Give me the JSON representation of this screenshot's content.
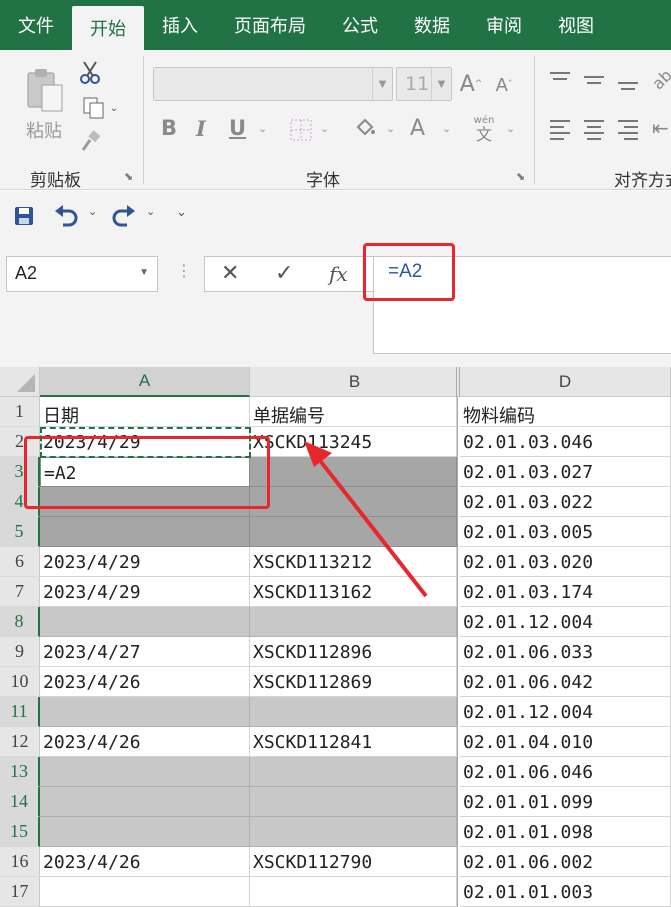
{
  "tabs": [
    "文件",
    "开始",
    "插入",
    "页面布局",
    "公式",
    "数据",
    "审阅",
    "视图"
  ],
  "active_tab": "开始",
  "clipboard": {
    "paste_label": "粘贴",
    "group_label": "剪贴板"
  },
  "font": {
    "size": "11",
    "group_label": "字体",
    "bold": "B",
    "italic": "I",
    "underline": "U",
    "font_color": "A",
    "grow": "A",
    "shrink": "A",
    "phonetic": "wén",
    "phonetic_char": "文"
  },
  "alignment": {
    "group_label": "对齐方式"
  },
  "formula_bar": {
    "name_box": "A2",
    "cancel": "✕",
    "enter": "✓",
    "fx": "fx",
    "formula": "=A2"
  },
  "sheet": {
    "columns": [
      "A",
      "B",
      "D"
    ],
    "editing_value": "=A2",
    "rows": [
      {
        "num": "1",
        "a": "日期",
        "b": "单据编号",
        "d": "物料编码",
        "style": "normal"
      },
      {
        "num": "2",
        "a": "2023/4/29",
        "b": "XSCKD113245",
        "d": "02.01.03.046",
        "style": "normal"
      },
      {
        "num": "3",
        "a": "",
        "b": "",
        "d": "02.01.03.027",
        "style": "dark"
      },
      {
        "num": "4",
        "a": "",
        "b": "",
        "d": "02.01.03.022",
        "style": "dark"
      },
      {
        "num": "5",
        "a": "",
        "b": "",
        "d": "02.01.03.005",
        "style": "dark"
      },
      {
        "num": "6",
        "a": "2023/4/29",
        "b": "XSCKD113212",
        "d": "02.01.03.020",
        "style": "normal"
      },
      {
        "num": "7",
        "a": "2023/4/29",
        "b": "XSCKD113162",
        "d": "02.01.03.174",
        "style": "normal"
      },
      {
        "num": "8",
        "a": "",
        "b": "",
        "d": "02.01.12.004",
        "style": "light"
      },
      {
        "num": "9",
        "a": "2023/4/27",
        "b": "XSCKD112896",
        "d": "02.01.06.033",
        "style": "normal"
      },
      {
        "num": "10",
        "a": "2023/4/26",
        "b": "XSCKD112869",
        "d": "02.01.06.042",
        "style": "normal"
      },
      {
        "num": "11",
        "a": "",
        "b": "",
        "d": "02.01.12.004",
        "style": "light"
      },
      {
        "num": "12",
        "a": "2023/4/26",
        "b": "XSCKD112841",
        "d": "02.01.04.010",
        "style": "normal"
      },
      {
        "num": "13",
        "a": "",
        "b": "",
        "d": "02.01.06.046",
        "style": "light"
      },
      {
        "num": "14",
        "a": "",
        "b": "",
        "d": "02.01.01.099",
        "style": "light"
      },
      {
        "num": "15",
        "a": "",
        "b": "",
        "d": "02.01.01.098",
        "style": "light"
      },
      {
        "num": "16",
        "a": "2023/4/26",
        "b": "XSCKD112790",
        "d": "02.01.06.002",
        "style": "normal"
      },
      {
        "num": "17",
        "a": "",
        "b": "",
        "d": "02.01.01.003",
        "style": "normal"
      }
    ]
  },
  "colors": {
    "excel_green": "#217346",
    "highlight_red": "#e8272c",
    "gray_dark": "#a6a6a6",
    "gray_light": "#c8c8c8"
  }
}
